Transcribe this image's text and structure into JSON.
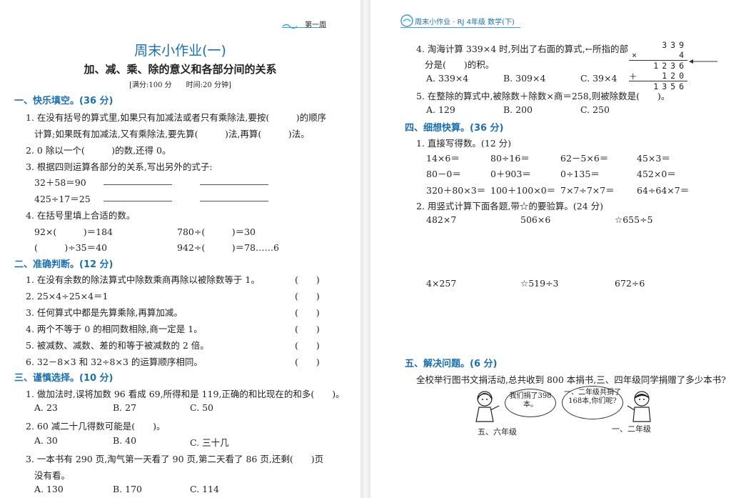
{
  "left": {
    "week_tag": "第一周",
    "title": "周末小作业(一)",
    "subtitle": "加、减、乘、除的意义和各部分间的关系",
    "meta": "[满分:100 分　　时间:20 分钟]",
    "s1": {
      "heading": "一、快乐填空。(36 分)",
      "q1a": "1. 在没有括号的算式里,如果只有加减法或者只有乘除法,要按(　　　)的顺序",
      "q1b": "计算;如果既有加减法,又有乘除法,要先算(　　　)法,再算(　　　)法。",
      "q2": "2. 0 除以一个(　　　)的数,还得 0。",
      "q3": "3. 根据四则运算各部分的关系,写出另外的式子:",
      "q3_eq1": "32＋58＝90",
      "q3_eq2": "425÷17＝25",
      "q4": "4. 在括号里填上合适的数。",
      "q4_a": "92×(　　　)＝184",
      "q4_b": "780÷(　　　)＝30",
      "q4_c": "(　　　)÷35＝40",
      "q4_d": "942÷(　　　)＝78……6"
    },
    "s2": {
      "heading": "二、准确判断。(12 分)",
      "items": [
        "1. 在没有余数的除法算式中除数乘商再除以被除数等于 1。",
        "2. 25×4÷25×4＝1",
        "3. 任何算式中都是先算乘除,再算加减。",
        "4. 两个不等于 0 的相同数相除,商一定是 1。",
        "5. 被减数、减数、差的和等于被减数的 2 倍。",
        "6. 32－8×3 和 32÷8×3 的运算顺序相同。"
      ],
      "paren": "(　　)"
    },
    "s3": {
      "heading": "三、谨慎选择。(10 分)",
      "q1": "1. 做加法时,误将加数 96 看成 69,所得和是 119,正确的和比现在的和多(　　)。",
      "q1_opts": [
        "A. 23",
        "B. 27",
        "C. 50"
      ],
      "q2": "2. 60 减二十几得数可能是(　　)。",
      "q2_opts": [
        "A. 30",
        "B. 40",
        "C. 三十几"
      ],
      "q3a": "3. 一本书有 290 页,淘气第一天看了 90 页,第二天看了 86 页,还剩(　　)页",
      "q3b": "没有看。",
      "q3_opts": [
        "A. 130",
        "B. 170",
        "C. 114"
      ]
    }
  },
  "right": {
    "header": "周末小作业 · RJ 4年级 数学(下)",
    "q4a": "4. 淘海计算 339×4 时,列出了右面的算式,←所指的部",
    "q4b": "分是(　　)的积。",
    "q4_opts": [
      "A. 339×4",
      "B. 309×4",
      "C. 39×4"
    ],
    "vertical": {
      "r1": "339",
      "r2_op": "×",
      "r2": "4",
      "r3": "1236",
      "r4_op": "＋",
      "r4": "120",
      "r5": "1356"
    },
    "q5": "5. 在整除的算式中,被除数＋除数×商＝258,则被除数是(　　)。",
    "q5_opts": [
      "A. 129",
      "B. 200",
      "C. 250"
    ],
    "s4": {
      "heading": "四、细想快算。(36 分)",
      "q1": "1. 直接写得数。(12 分)",
      "rows": [
        [
          "14×6＝",
          "80÷16＝",
          "62－5×6＝",
          "45×3＝"
        ],
        [
          "80－0＝",
          "0＋903＝",
          "0÷135＝",
          "452×0＝"
        ],
        [
          "320＋80×3＝",
          "100＋100×0＝",
          "7×7÷7×7＝",
          "64÷64×7＝"
        ]
      ],
      "q2": "2. 用竖式计算下面各题,带☆的要验算。(24 分)",
      "calc_row1": [
        "482×7",
        "506×6",
        "☆655÷5"
      ],
      "calc_row2": [
        "4×257",
        "☆519÷3",
        "672÷6"
      ]
    },
    "s5": {
      "heading": "五、解决问题。(6 分)",
      "question": "全校举行图书文捐活动,总共收到 800 本捐书,三、四年级同学捐赠了多少本书?",
      "bubble1": "我们捐了398本。",
      "bubble2": "一、二年级共捐了168本,你们呢?",
      "caption1": "五、六年级",
      "caption2": "一、二年级"
    }
  }
}
